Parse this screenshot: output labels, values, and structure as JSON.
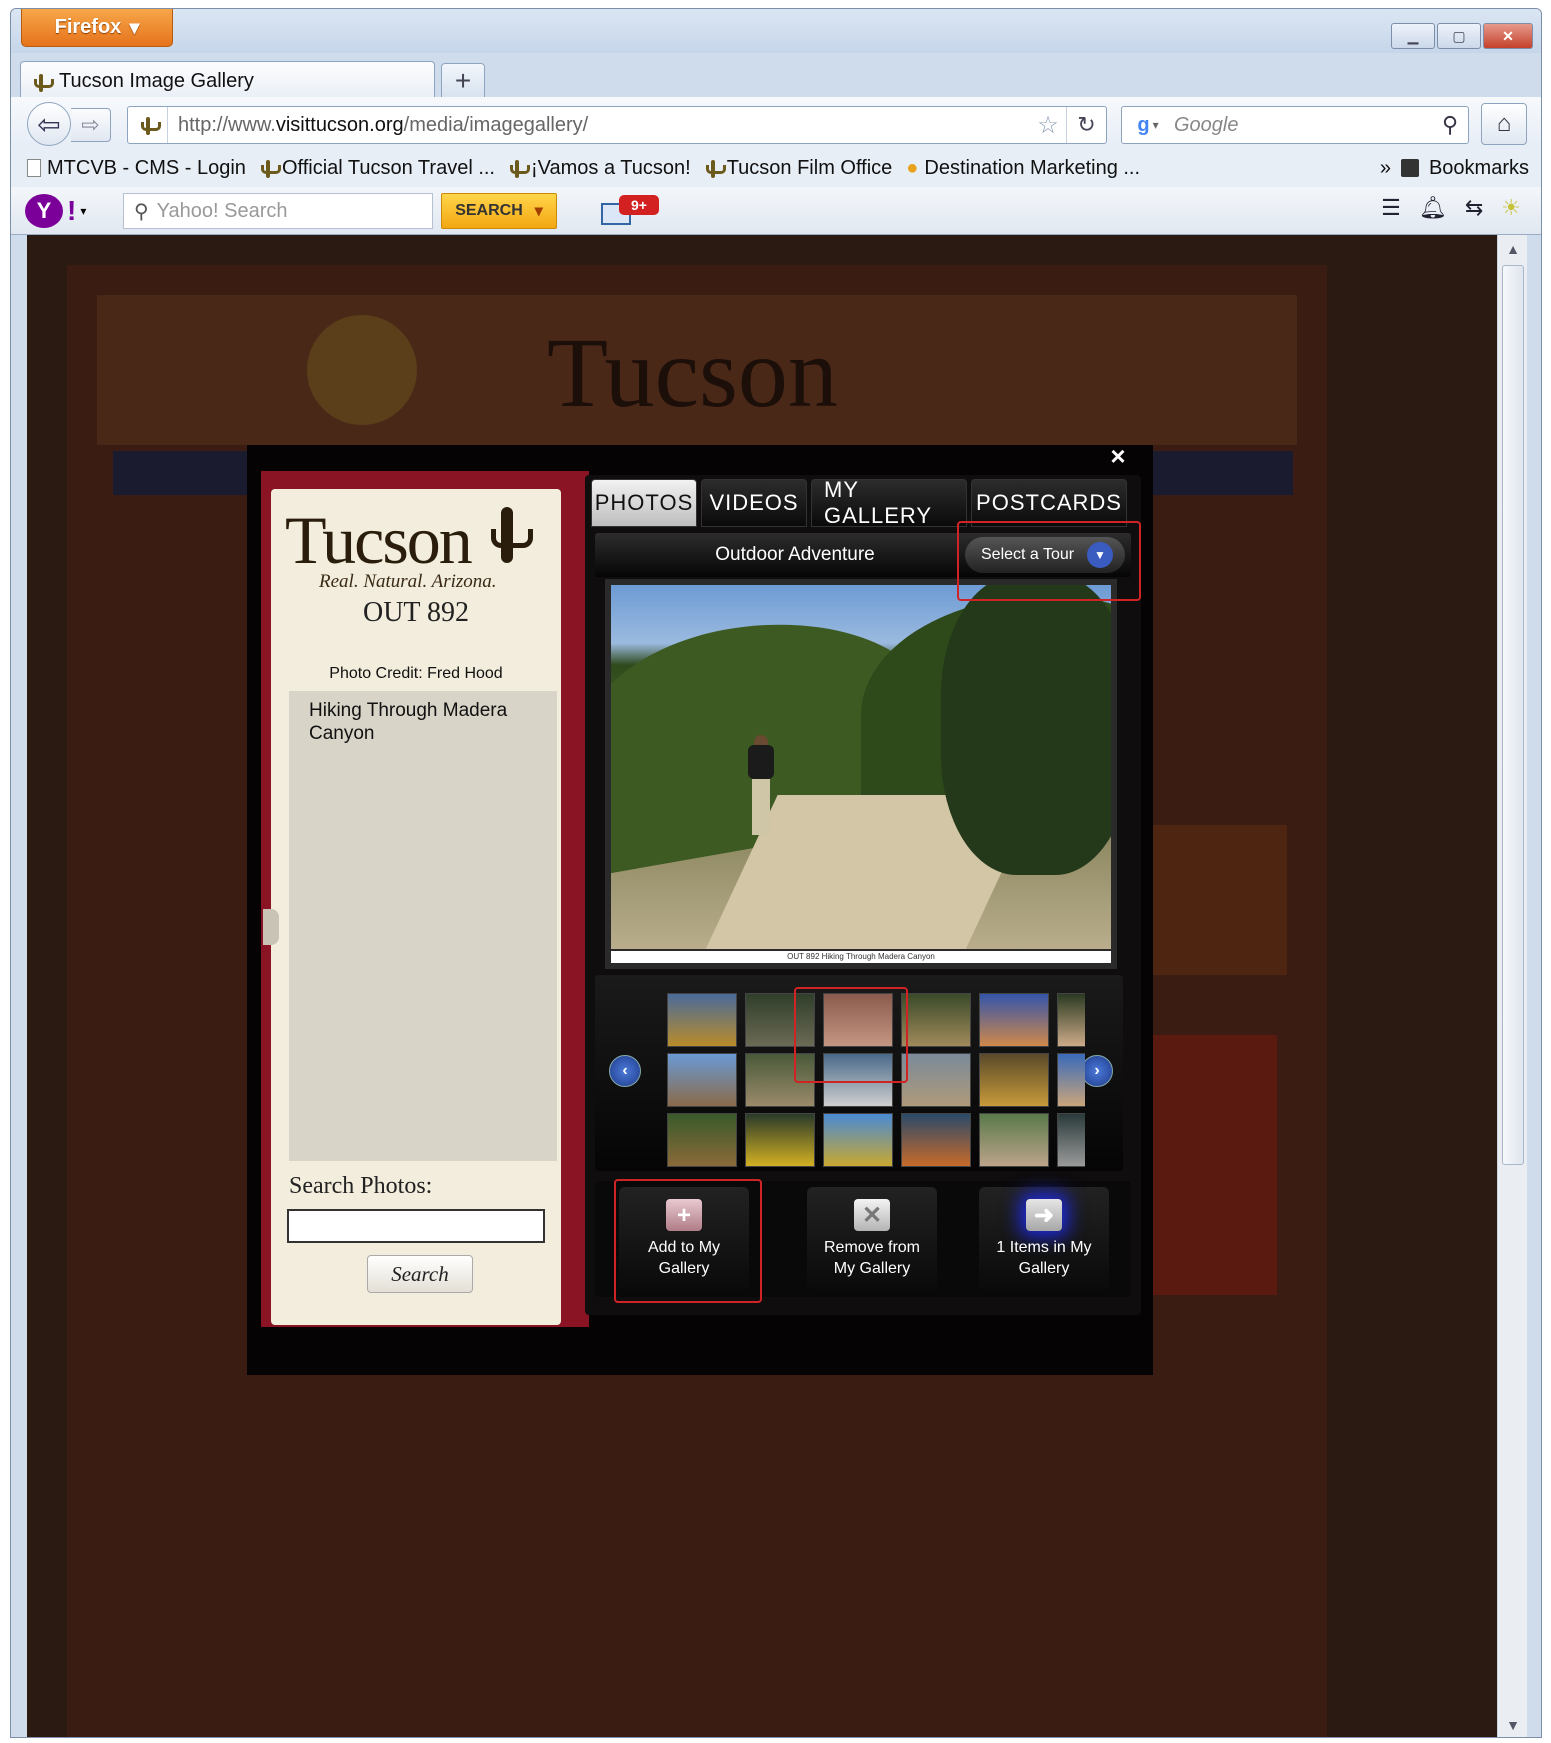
{
  "browser": {
    "app_button": "Firefox",
    "tab_title": "Tucson Image Gallery",
    "new_tab_icon": "plus-icon",
    "url_prefix": "http://www.",
    "url_domain": "visittucson.org",
    "url_path": "/media/imagegallery/",
    "search_engine": "Google",
    "bookmarks": [
      "MTCVB - CMS - Login",
      "Official Tucson Travel ...",
      "¡Vamos a Tucson!",
      "Tucson Film Office",
      "Destination Marketing ..."
    ],
    "bookmarks_menu": "Bookmarks",
    "chevron": "»"
  },
  "yahoo_toolbar": {
    "search_placeholder": "Yahoo! Search",
    "search_button": "SEARCH",
    "mail_badge": "9+"
  },
  "gallery": {
    "logo_word": "Tucson",
    "logo_tagline": "Real. Natural. Arizona.",
    "photo_id": "OUT 892",
    "photo_credit": "Photo Credit: Fred Hood",
    "description": "Hiking Through Madera Canyon",
    "search_label": "Search Photos:",
    "search_value": "",
    "search_button": "Search",
    "tabs": [
      "PHOTOS",
      "VIDEOS",
      "MY GALLERY",
      "POSTCARDS"
    ],
    "active_tab": "PHOTOS",
    "tour_title": "Outdoor Adventure",
    "tour_select": "Select a Tour",
    "caption": "OUT 892 Hiking Through Madera Canyon",
    "actions": {
      "add": "Add to My Gallery",
      "remove": "Remove from My Gallery",
      "count": "1 Items in My Gallery"
    },
    "close_icon": "×"
  },
  "colors": {
    "accent_red": "#d02323",
    "card_red": "#8b1424",
    "firefox_orange": "#e5731b"
  }
}
